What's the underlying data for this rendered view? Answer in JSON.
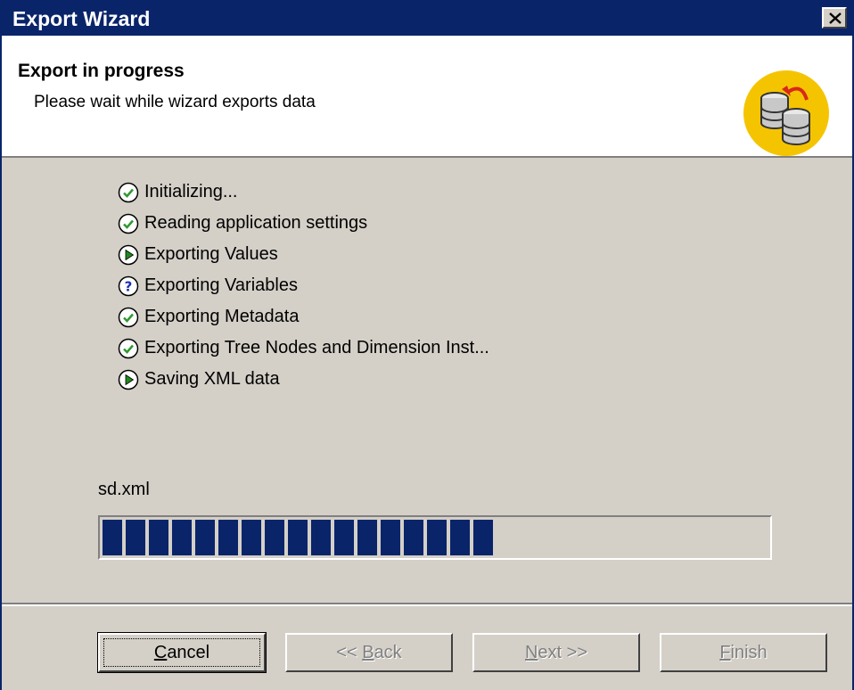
{
  "window": {
    "title": "Export Wizard",
    "close_icon": "close-icon"
  },
  "header": {
    "title": "Export in progress",
    "subtitle": "Please wait while wizard exports data",
    "icon": "database-export-icon"
  },
  "steps": [
    {
      "label": "Initializing...",
      "status": "done",
      "icon": "check-icon"
    },
    {
      "label": "Reading application settings",
      "status": "done",
      "icon": "check-icon"
    },
    {
      "label": "Exporting Values",
      "status": "in-progress",
      "icon": "play-icon"
    },
    {
      "label": "Exporting Variables",
      "status": "unknown",
      "icon": "question-icon"
    },
    {
      "label": "Exporting Metadata",
      "status": "done",
      "icon": "check-icon"
    },
    {
      "label": "Exporting Tree Nodes and Dimension Inst...",
      "status": "done",
      "icon": "check-icon"
    },
    {
      "label": "Saving XML data",
      "status": "in-progress",
      "icon": "play-icon"
    }
  ],
  "progress": {
    "filename": "sd.xml",
    "filled_segments": 17,
    "total_segments": 29,
    "fraction": 0.7
  },
  "buttons": {
    "cancel": {
      "first": "C",
      "rest": "ancel",
      "enabled": true
    },
    "back": {
      "pre": "<< ",
      "first": "B",
      "rest": "ack",
      "enabled": false
    },
    "next": {
      "first": "N",
      "rest": "ext >>",
      "enabled": false
    },
    "finish": {
      "first": "F",
      "rest": "inish",
      "enabled": false
    }
  },
  "colors": {
    "title_bar": "#0a246a",
    "progress_fill": "#0a246a",
    "dialog_bg": "#d4d0c8",
    "check_green": "#2e9a2e",
    "question_blue": "#1a2fb0",
    "icon_yellow": "#f5c400"
  }
}
